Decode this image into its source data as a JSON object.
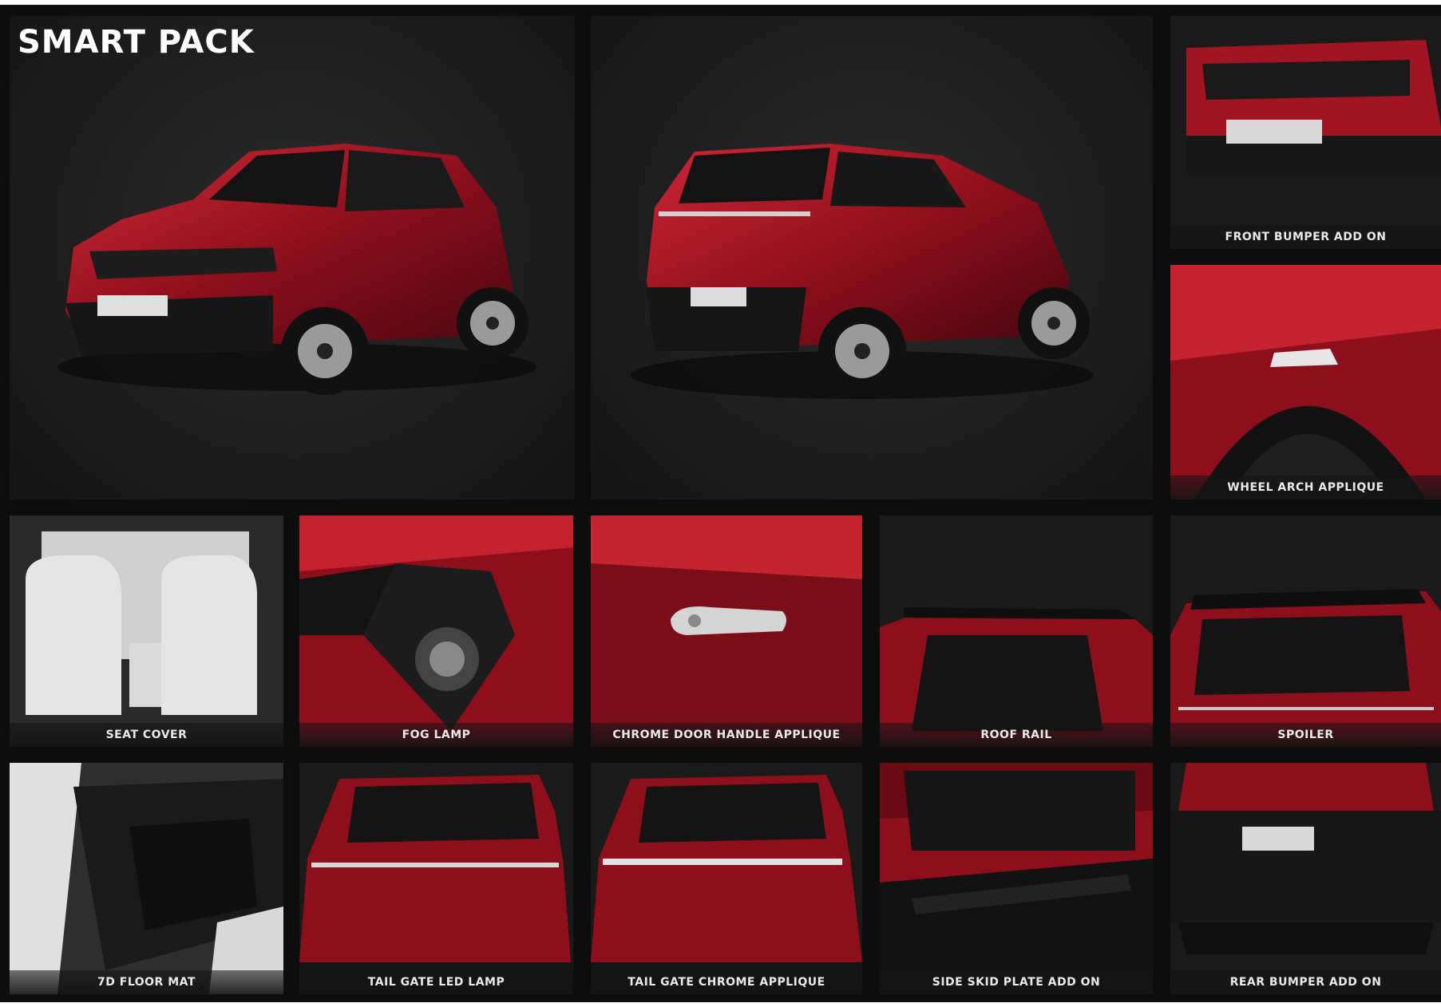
{
  "title": "SMART PACK",
  "colors": {
    "body_red": "#8e0f1c",
    "body_red_light": "#c4202f",
    "trim_black": "#151515",
    "tile_bg": "#1b1b1b",
    "caption_text": "#e9e9e9"
  },
  "tiles": [
    {
      "caption": "",
      "icon": "suv-front-three-quarter-image"
    },
    {
      "caption": "",
      "icon": "suv-rear-three-quarter-image"
    },
    {
      "caption": "FRONT BUMPER ADD ON",
      "icon": "front-bumper-image"
    },
    {
      "caption": "WHEEL ARCH APPLIQUE",
      "icon": "wheel-arch-image"
    },
    {
      "caption": "SEAT COVER",
      "icon": "seat-cover-image"
    },
    {
      "caption": "FOG LAMP",
      "icon": "fog-lamp-image"
    },
    {
      "caption": "CHROME DOOR HANDLE APPLIQUE",
      "icon": "door-handle-image"
    },
    {
      "caption": "ROOF RAIL",
      "icon": "roof-rail-image"
    },
    {
      "caption": "SPOILER",
      "icon": "spoiler-image"
    },
    {
      "caption": "7D FLOOR MAT",
      "icon": "floor-mat-image"
    },
    {
      "caption": "TAIL GATE LED LAMP",
      "icon": "tail-gate-led-image"
    },
    {
      "caption": "TAIL GATE CHROME APPLIQUE",
      "icon": "tail-gate-chrome-image"
    },
    {
      "caption": "SIDE SKID PLATE ADD ON",
      "icon": "side-skid-plate-image"
    },
    {
      "caption": "REAR BUMPER ADD ON",
      "icon": "rear-bumper-image"
    }
  ]
}
